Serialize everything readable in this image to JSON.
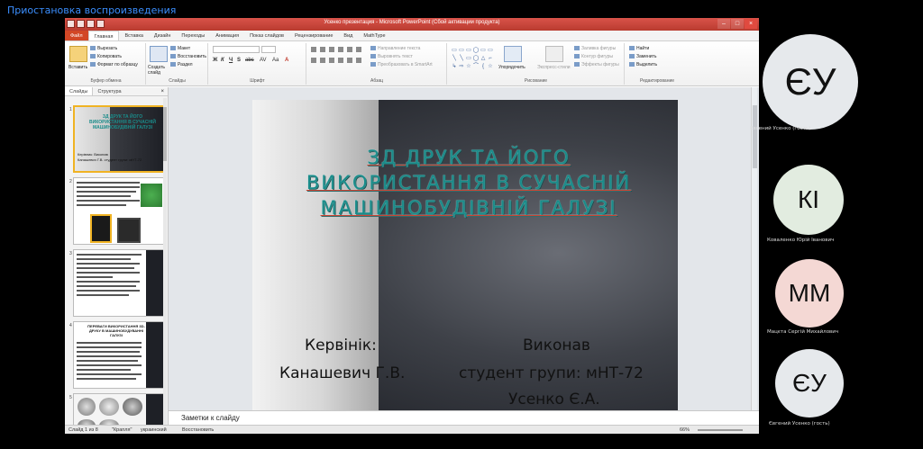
{
  "banner": {
    "text": "Приостановка воспроизведения"
  },
  "window": {
    "title": "Усенко презентация - Microsoft PowerPoint (Сбой активации продукта)",
    "controls": [
      "–",
      "□",
      "×"
    ]
  },
  "tabs": [
    "Файл",
    "Главная",
    "Вставка",
    "Дизайн",
    "Переходы",
    "Анимация",
    "Показ слайдов",
    "Рецензирование",
    "Вид",
    "MathType"
  ],
  "ribbon": {
    "clipboard": {
      "paste": "Вставить",
      "cut": "Вырезать",
      "copy": "Копировать",
      "format_painter": "Формат по образцу",
      "label": "Буфер обмена"
    },
    "slides": {
      "new_slide": "Создать слайд",
      "layout": "Макет",
      "reset": "Восстановить",
      "section": "Раздел",
      "label": "Слайды"
    },
    "font": {
      "label": "Шрифт",
      "buttons": [
        "Ж",
        "К",
        "Ч",
        "S",
        "abc",
        "AV",
        "Aa",
        "A"
      ]
    },
    "paragraph": {
      "text_direction": "Направление текста",
      "align_text": "Выровнять текст",
      "smartart": "Преобразовать в SmartArt",
      "label": "Абзац"
    },
    "drawing": {
      "arrange": "Упорядочить",
      "quick_styles": "Экспресс-стили",
      "shape_fill": "Заливка фигуры",
      "shape_outline": "Контур фигуры",
      "shape_effects": "Эффекты фигуры",
      "label": "Рисование"
    },
    "editing": {
      "find": "Найти",
      "replace": "Заменить",
      "select": "Выделить",
      "label": "Редактирование"
    }
  },
  "panel": {
    "tabs": [
      "Слайды",
      "Структура"
    ],
    "close": "×",
    "thumbs": [
      {
        "num": "1",
        "lines": [
          "ЗД ДРУК ТА ЙОГО",
          "ВИКОРИСТАННЯ В СУЧАСНІЙ",
          "МАШИНОБУДІВНІЙ ГАЛУЗІ",
          "Керівник:  Виконав",
          "Канашевич Г.В.  студент групи: мНТ-72"
        ]
      },
      {
        "num": "2"
      },
      {
        "num": "3"
      },
      {
        "num": "4",
        "title": "ПЕРЕВАГИ ВИКОРИСТАННЯ 3D-ДРУКУ В МАШИНОБУДУВАННІ ГАЛУЗІ"
      },
      {
        "num": "5"
      }
    ]
  },
  "slide": {
    "title_lines": [
      "ЗД ДРУК ТА ЙОГО",
      "ВИКОРИСТАННЯ В СУЧАСНІЙ",
      "МАШИНОБУДІВНІЙ ГАЛУЗІ"
    ],
    "supervisor_label": "Кервінік:",
    "supervisor_name": "Канашевич Г.В.",
    "executor_label": "Виконав",
    "executor_group": "студент групи: мНТ-72",
    "executor_name": "Усенко Є.А."
  },
  "notes": {
    "placeholder": "Заметки к слайду"
  },
  "status": {
    "slide_counter": "Слайд 1 из 8",
    "theme": "\"Крапля\"",
    "language": "украинский",
    "restore": "Восстановить",
    "zoom": "66%"
  },
  "participants": [
    {
      "initials": "ЄУ",
      "name": "Евгений Усенко (гость)",
      "bg": "#e6e9ec"
    },
    {
      "initials": "КІ",
      "name": "Коваленко Юрій Іванович",
      "bg": "#e2ece0"
    },
    {
      "initials": "ММ",
      "name": "Мацєта Сергій Михайлович",
      "bg": "#f4d8d4"
    },
    {
      "initials": "ЄУ",
      "name": "Євгений Усенко (гость)",
      "bg": "#e6e9ec"
    }
  ],
  "colors": {
    "accent": "#d24726",
    "title_teal": "#1a8c8a",
    "banner_text": "#3b8fff",
    "selected_thumb": "#f0b323"
  }
}
